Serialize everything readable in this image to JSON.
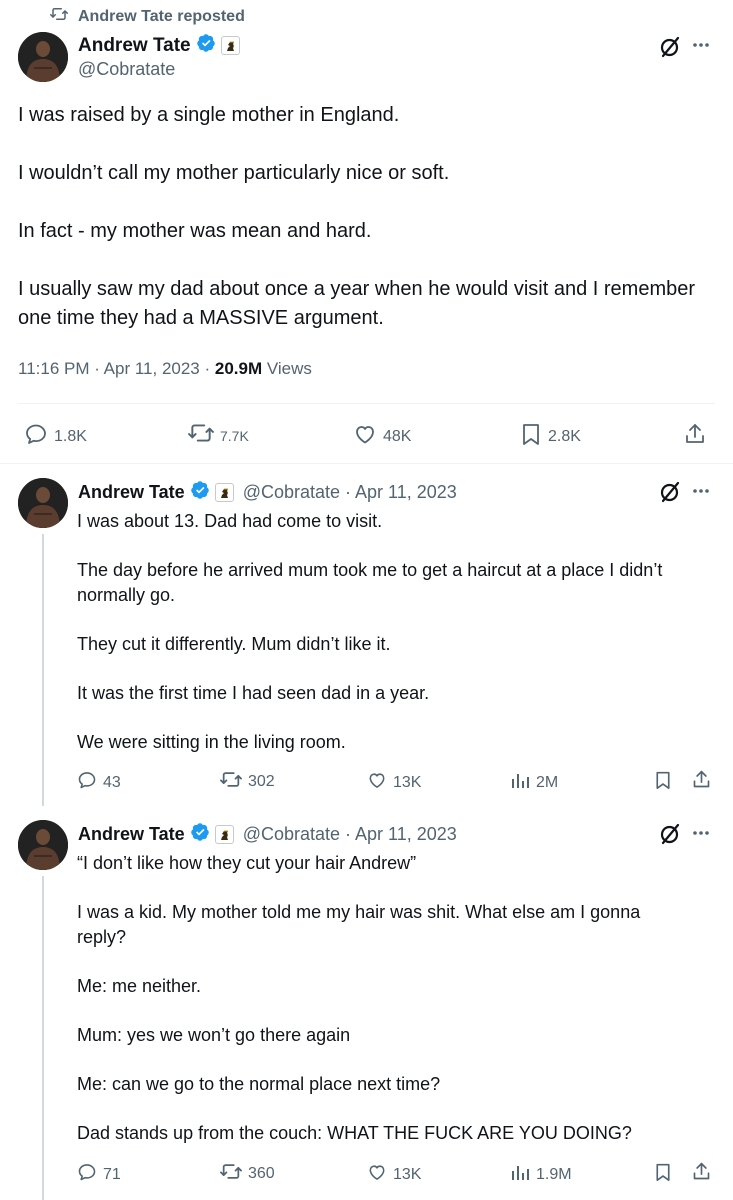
{
  "repost": {
    "label": "Andrew Tate reposted"
  },
  "main": {
    "author_name": "Andrew Tate",
    "handle": "@Cobratate",
    "paragraphs": [
      "I was raised by a single mother in England.",
      "I wouldn’t call my mother particularly nice or soft.",
      "In fact - my mother was mean and hard.",
      "I usually saw my dad about once a year when he would visit and I remember one time they had a MASSIVE argument."
    ],
    "time": "11:16 PM · Apr 11, 2023 · ",
    "views_count": "20.9M",
    "views_label": " Views",
    "replies": "1.8K",
    "reposts": "7.7K",
    "likes": "48K",
    "bookmarks": "2.8K"
  },
  "reply1": {
    "author_name": "Andrew Tate",
    "handle_date": "@Cobratate · Apr 11, 2023",
    "paragraphs": [
      "I was about 13. Dad had come to visit.",
      "The day before he arrived mum took me to get a haircut at a place I didn’t normally go.",
      "They cut it differently. Mum didn’t like it.",
      "It was the first time I had seen dad in a year.",
      "We were sitting in the living room."
    ],
    "replies": "43",
    "reposts": "302",
    "likes": "13K",
    "views": "2M"
  },
  "reply2": {
    "author_name": "Andrew Tate",
    "handle_date": "@Cobratate · Apr 11, 2023",
    "paragraphs": [
      "“I don’t like how they cut your hair Andrew”",
      "I was a kid. My mother told me my hair was shit. What else am I gonna reply?",
      "Me: me neither.",
      "Mum: yes we won’t go there again",
      "Me: can we go to the normal place next time?",
      "Dad stands up from the couch: WHAT THE FUCK ARE YOU DOING?"
    ],
    "replies": "71",
    "reposts": "360",
    "likes": "13K",
    "views": "1.9M"
  },
  "colors": {
    "text": "#0f1419",
    "muted": "#536471",
    "verified": "#1d9bf0",
    "thread_line": "#cfd9de"
  },
  "icons": [
    "repost-icon",
    "verified-icon",
    "affiliate-badge-icon",
    "grok-icon",
    "more-icon",
    "reply-icon",
    "like-icon",
    "bookmark-icon",
    "share-icon",
    "views-icon"
  ]
}
